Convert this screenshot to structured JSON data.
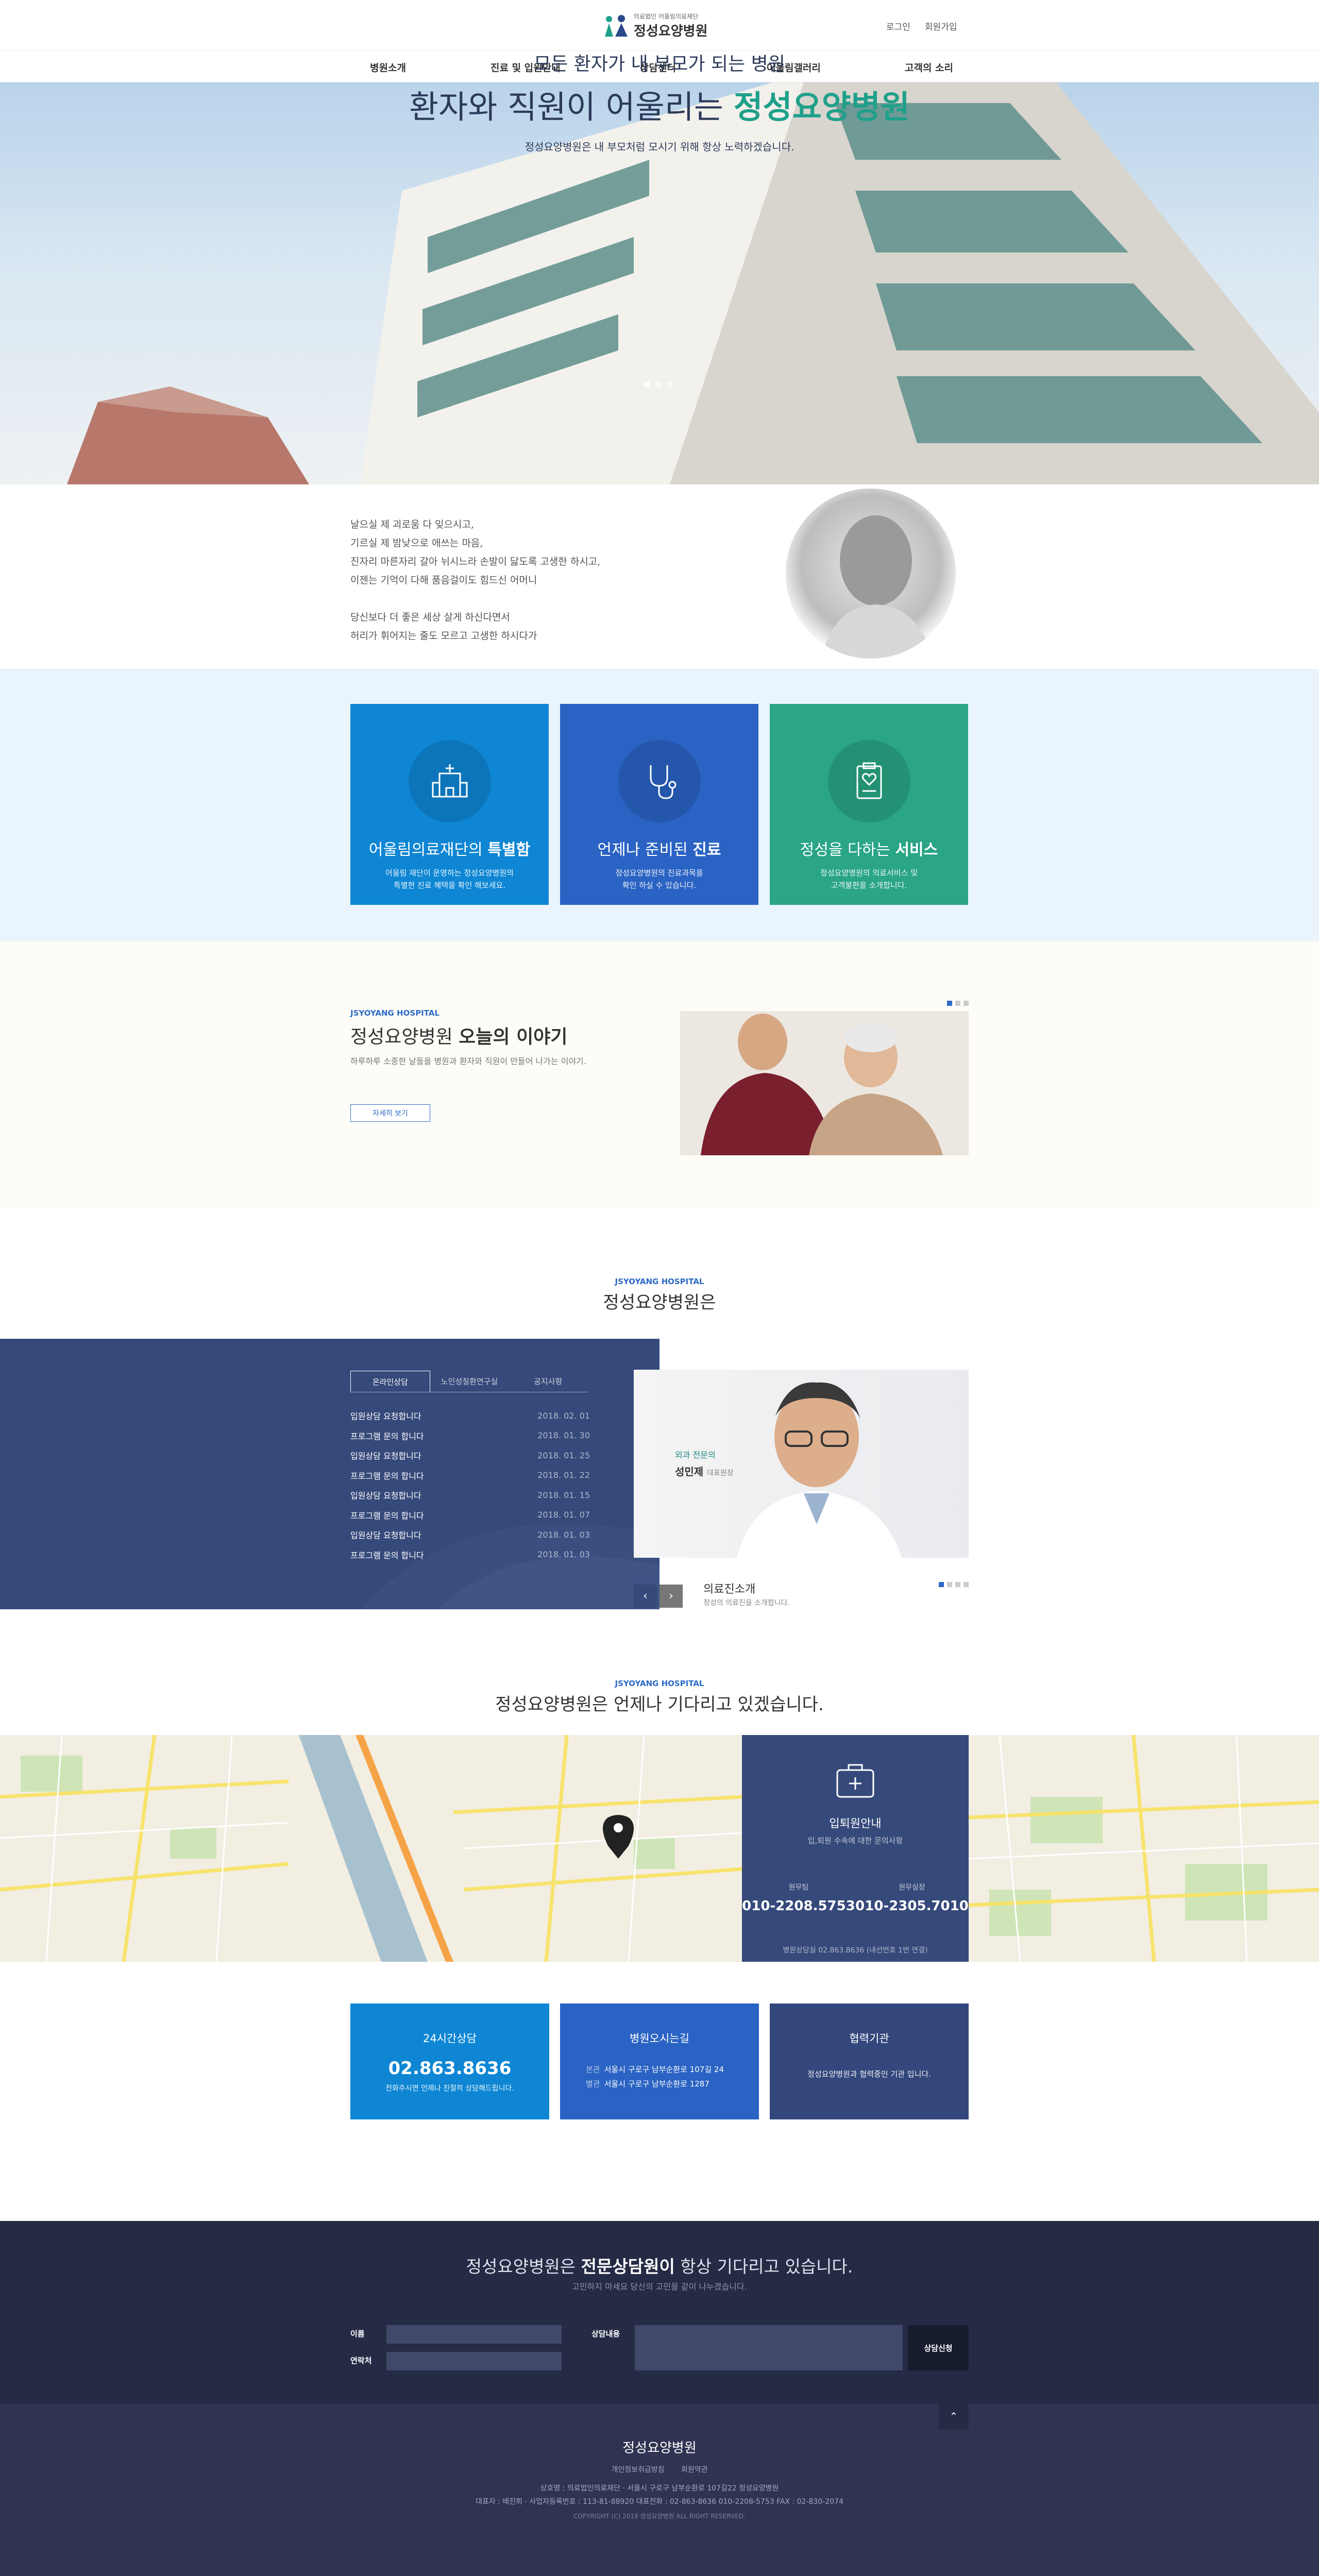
{
  "header": {
    "logo_sub": "의료법인 어울림의료재단",
    "logo_main": "정성요양병원",
    "login": "로그인",
    "join": "회원가입",
    "nav": [
      "병원소개",
      "진료 및 입원안내",
      "상담센터",
      "어울림갤러리",
      "고객의 소리"
    ]
  },
  "hero": {
    "line1": "모든 환자가 내 부모가 되는 병원",
    "line2_prefix": "환자와 직원이 어울리는 ",
    "line2_em": "정성요양병원",
    "line3": "정성요양병원은 내 부모처럼 모시기 위해 항상 노력하겠습니다."
  },
  "poem": [
    "날으실 제 괴로움 다 잊으시고,",
    "기르실 제 밤낮으로 애쓰는 마음,",
    "진자리 마른자리 갈아 뉘시느라 손발이 닳도록 고생한 하시고,",
    "이젠는 기억이 다해 품음걸이도 힘드신 어머니",
    "",
    "당신보다 더 좋은 세상 살게 하신다면서",
    "허리가 휘어지는 줄도 모르고 고생한 하시다가"
  ],
  "features": [
    {
      "title_pre": "어울림의료재단의 ",
      "title_em": "특별함",
      "desc1": "어울림 재단이 운영하는 정성요양병원의",
      "desc2": "특별한 진료 혜택을 확인 해보세요.",
      "icon": "hospital-icon",
      "color": "#0e86d4"
    },
    {
      "title_pre": "언제나 준비된 ",
      "title_em": "진료",
      "desc1": "정성요양병원의 진료과목을",
      "desc2": "확인 하실 수 있습니다.",
      "icon": "stethoscope-icon",
      "color": "#2a63c3"
    },
    {
      "title_pre": "정성을 다하는 ",
      "title_em": "서비스",
      "desc1": "정성요양병원의 의료서비스 및",
      "desc2": "고객불편을 소개합니다.",
      "icon": "clipboard-heart-icon",
      "color": "#2aa585"
    }
  ],
  "story": {
    "en": "JSYOYANG HOSPITAL",
    "title_pre": "정성요양병원 ",
    "title_em": "오늘의 이야기",
    "desc": "하루하루 소중한 날들을 병원과 환자와 직원이 만들어 나가는 이야기.",
    "button": "자세히 보기"
  },
  "intro": {
    "en": "JSYOYANG HOSPITAL",
    "title": "정성요양병원은",
    "tabs": [
      "온라인상담",
      "노인성질환연구실",
      "공지사항"
    ],
    "board": [
      {
        "title": "입원상담 요청합니다",
        "date": "2018. 02. 01"
      },
      {
        "title": "프로그램 문의 합니다",
        "date": "2018. 01. 30"
      },
      {
        "title": "입원상담 요청합니다",
        "date": "2018. 01. 25"
      },
      {
        "title": "프로그램 문의 합니다",
        "date": "2018. 01. 22"
      },
      {
        "title": "입원상담 요청합니다",
        "date": "2018. 01. 15"
      },
      {
        "title": "프로그램 문의 합니다",
        "date": "2018. 01. 07"
      },
      {
        "title": "입원상담 요청합니다",
        "date": "2018. 01. 03"
      },
      {
        "title": "프로그램 문의 합니다",
        "date": "2018. 01. 03"
      }
    ],
    "doctor_role": "외과 전문의",
    "doctor_name": "성민제",
    "doctor_title": "대표원장",
    "med_title": "의료진소개",
    "med_desc": "정성의 의료진을 소개합니다."
  },
  "map": {
    "en": "JSYOYANG HOSPITAL",
    "title": "정성요양병원은 언제나 기다리고 있겠습니다.",
    "admit_title": "입퇴원안내",
    "admit_sub": "입,퇴원 수속에 대한 문의사항",
    "phones": [
      {
        "label": "원무팀",
        "num": "010-2208.5753"
      },
      {
        "label": "원무실장",
        "num": "010-2305.7010"
      }
    ],
    "admit_foot": "병원상담실 02.863.8636 (내선번호 1번 연결)"
  },
  "info": [
    {
      "title": "24시간상담",
      "num": "02.863.8636",
      "desc": "전화주시면 언제나 친절히 상담해드립니다.",
      "color": "#0e86d4"
    },
    {
      "title": "병원오시는길",
      "addr": [
        {
          "k": "본관",
          "v": "서울시 구로구 남부순환로 107길 24"
        },
        {
          "k": "별관",
          "v": "서울시 구로구 남부순환로 1287"
        }
      ],
      "color": "#2a63c3"
    },
    {
      "title": "협력기관",
      "desc": "정성요양병원과 협력중인 기관 입니다.",
      "color": "#33477c"
    }
  ],
  "consult": {
    "title_pre": "정성요양병원은 ",
    "title_em": "전문상담원이",
    "title_post": " 항상 기다리고 있습니다.",
    "sub": "고민하지 마세요 당신의 고민을 같이 나누겠습니다.",
    "name_label": "이름",
    "contact_label": "연락처",
    "content_label": "상담내용",
    "submit": "상담신청"
  },
  "footer": {
    "name": "정성요양병원",
    "links": [
      "개인정보취급방침",
      "회원약관"
    ],
    "addr": "상호명 : 의료법인의료재단 · 서울시 구로구 남부순환로 107길22 정성요양병원",
    "tel": "대표자 : 배진희 · 사업자등록번호 : 113-81-88920 대표전화 : 02-863-8636 010-2208-5753 FAX : 02-830-2074",
    "copy": "COPYRIGHT (C) 2018 정성요양병원 ALL RIGHT RESERVED."
  }
}
